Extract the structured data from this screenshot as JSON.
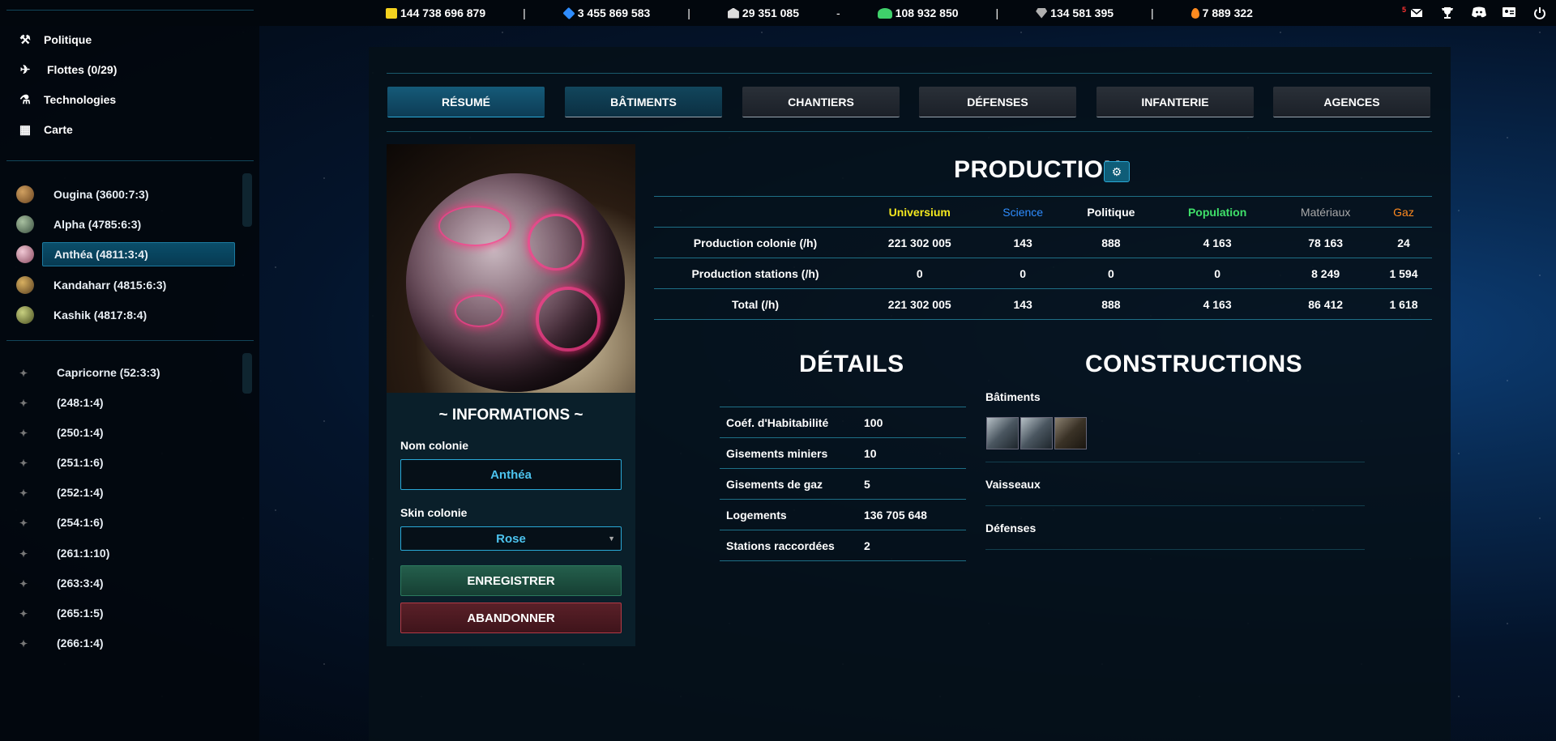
{
  "topbar": {
    "resources": [
      {
        "name": "money",
        "value": "144 738 696 879",
        "color": "#f4d21f",
        "icon": "money-icon"
      },
      {
        "name": "science",
        "value": "3 455 869 583",
        "color": "#2f8dff",
        "icon": "cube-icon"
      },
      {
        "name": "politics",
        "value": "29 351 085",
        "color": "#dddddd",
        "icon": "bank-icon"
      },
      {
        "name": "population",
        "value": "108 932 850",
        "color": "#3fd06a",
        "icon": "people-icon"
      },
      {
        "name": "materials",
        "value": "134 581 395",
        "color": "#b0b0b0",
        "icon": "diamond-icon"
      },
      {
        "name": "gas",
        "value": "7 889 322",
        "color": "#ff8a1f",
        "icon": "flame-icon"
      }
    ],
    "separators": [
      "|",
      "|",
      "-",
      "|",
      "|",
      "|"
    ],
    "mail_badge": "5"
  },
  "sidebar": {
    "nav": [
      {
        "label": "Politique",
        "icon": "gavel-icon"
      },
      {
        "label": "Flottes (0/29)",
        "icon": "plane-icon"
      },
      {
        "label": "Technologies",
        "icon": "flask-icon"
      },
      {
        "label": "Carte",
        "icon": "map-icon"
      }
    ],
    "planets": [
      {
        "label": "Ougina (3600:7:3)",
        "color": "#a07a3a"
      },
      {
        "label": "Alpha (4785:6:3)",
        "color": "#6c8a6a"
      },
      {
        "label": "Anthéa (4811:3:4)",
        "color": "#c98c9c"
      },
      {
        "label": "Kandaharr (4815:6:3)",
        "color": "#a98640"
      },
      {
        "label": "Kashik (4817:8:4)",
        "color": "#9aa050"
      }
    ],
    "stations": [
      {
        "label": "Capricorne (52:3:3)"
      },
      {
        "label": "(248:1:4)"
      },
      {
        "label": "(250:1:4)"
      },
      {
        "label": "(251:1:6)"
      },
      {
        "label": "(252:1:4)"
      },
      {
        "label": "(254:1:6)"
      },
      {
        "label": "(261:1:10)"
      },
      {
        "label": "(263:3:4)"
      },
      {
        "label": "(265:1:5)"
      },
      {
        "label": "(266:1:4)"
      }
    ]
  },
  "tabs": [
    "RÉSUMÉ",
    "BÂTIMENTS",
    "CHANTIERS",
    "DÉFENSES",
    "INFANTERIE",
    "AGENCES"
  ],
  "card": {
    "title": "~ INFORMATIONS ~",
    "name_label": "Nom colonie",
    "name_value": "Anthéa",
    "skin_label": "Skin colonie",
    "skin_value": "Rose",
    "save_label": "ENREGISTRER",
    "abandon_label": "ABANDONNER"
  },
  "production": {
    "title": "PRODUCTION",
    "headers": [
      {
        "label": "Universium",
        "color": "#f4e81f"
      },
      {
        "label": "Science",
        "color": "#2f8dff"
      },
      {
        "label": "Politique",
        "color": "#ffffff"
      },
      {
        "label": "Population",
        "color": "#3fe06a"
      },
      {
        "label": "Matériaux",
        "color": "#a8a8a8"
      },
      {
        "label": "Gaz",
        "color": "#ff8a1f"
      }
    ],
    "rows": [
      {
        "label": "Production colonie (/h)",
        "values": [
          "221 302 005",
          "143",
          "888",
          "4 163",
          "78 163",
          "24"
        ]
      },
      {
        "label": "Production stations (/h)",
        "values": [
          "0",
          "0",
          "0",
          "0",
          "8 249",
          "1 594"
        ]
      },
      {
        "label": "Total (/h)",
        "values": [
          "221 302 005",
          "143",
          "888",
          "4 163",
          "86 412",
          "1 618"
        ]
      }
    ]
  },
  "details": {
    "title": "DÉTAILS",
    "rows": [
      {
        "label": "Coéf. d'Habitabilité",
        "value": "100"
      },
      {
        "label": "Gisements miniers",
        "value": "10"
      },
      {
        "label": "Gisements de gaz",
        "value": "5"
      },
      {
        "label": "Logements",
        "value": "136 705 648"
      },
      {
        "label": "Stations raccordées",
        "value": "2"
      }
    ]
  },
  "constructions": {
    "title": "CONSTRUCTIONS",
    "buildings_label": "Bâtiments",
    "ships_label": "Vaisseaux",
    "defenses_label": "Défenses"
  }
}
